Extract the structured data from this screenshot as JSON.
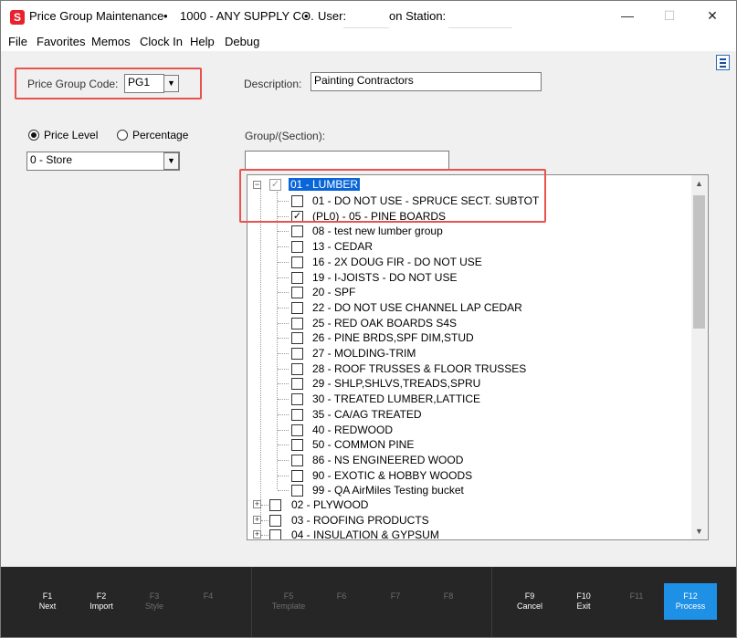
{
  "window": {
    "title": "Price Group Maintenance",
    "company": "1000 - ANY SUPPLY CO.",
    "user_label": "User:",
    "station_label": "on Station:",
    "bullet": "•",
    "minimize": "—",
    "maximize": "☐",
    "close": "✕",
    "app_icon_letter": "S"
  },
  "menu": [
    "File",
    "Favorites",
    "Memos",
    "Clock In",
    "Help",
    "Debug"
  ],
  "form": {
    "price_group_label": "Price Group Code:",
    "price_group_value": "PG1",
    "description_label": "Description:",
    "description_value": "Painting Contractors",
    "radio_price_level": "Price Level",
    "radio_percentage": "Percentage",
    "price_level_value": "0 - Store",
    "group_section_label": "Group/(Section):",
    "group_section_value": ""
  },
  "icons": {
    "dropdown": "▼",
    "collapse": "−",
    "expand": "+",
    "check": "✓",
    "scroll_up": "▲",
    "scroll_down": "▼"
  },
  "tree": {
    "root": {
      "label": "01 - LUMBER",
      "state": "partial",
      "expanded": true
    },
    "children": [
      {
        "label": "01 - DO NOT USE - SPRUCE SECT. SUBTOT",
        "checked": false
      },
      {
        "label": "(PL0) - 05 - PINE BOARDS",
        "checked": true
      },
      {
        "label": "08 - test new lumber group",
        "checked": false
      },
      {
        "label": "13 - CEDAR",
        "checked": false
      },
      {
        "label": "16 - 2X DOUG FIR - DO NOT USE",
        "checked": false
      },
      {
        "label": "19 - I-JOISTS - DO NOT USE",
        "checked": false
      },
      {
        "label": "20 - SPF",
        "checked": false
      },
      {
        "label": "22 - DO NOT USE      CHANNEL LAP CEDAR",
        "checked": false
      },
      {
        "label": "25 - RED OAK BOARDS S4S",
        "checked": false
      },
      {
        "label": "26 - PINE BRDS,SPF DIM,STUD",
        "checked": false
      },
      {
        "label": "27 - MOLDING-TRIM",
        "checked": false
      },
      {
        "label": "28 - ROOF TRUSSES & FLOOR TRUSSES",
        "checked": false
      },
      {
        "label": "29 - SHLP,SHLVS,TREADS,SPRU",
        "checked": false
      },
      {
        "label": "30 - TREATED LUMBER,LATTICE",
        "checked": false
      },
      {
        "label": "35 - CA/AG TREATED",
        "checked": false
      },
      {
        "label": "40 - REDWOOD",
        "checked": false
      },
      {
        "label": "50 - COMMON PINE",
        "checked": false
      },
      {
        "label": "86 - NS ENGINEERED WOOD",
        "checked": false
      },
      {
        "label": "90 - EXOTIC & HOBBY WOODS",
        "checked": false
      },
      {
        "label": "99 - QA AirMiles Testing bucket",
        "checked": false
      }
    ],
    "siblings": [
      {
        "label": "02 - PLYWOOD",
        "checked": false
      },
      {
        "label": "03 - ROOFING PRODUCTS",
        "checked": false
      },
      {
        "label": "04 - INSULATION & GYPSUM",
        "checked": false
      }
    ]
  },
  "fkeys": [
    {
      "key": "F1",
      "action": "Next",
      "enabled": true
    },
    {
      "key": "F2",
      "action": "Import",
      "enabled": true
    },
    {
      "key": "F3",
      "action": "Style",
      "enabled": false
    },
    {
      "key": "F4",
      "action": "",
      "enabled": false
    },
    {
      "key": "F5",
      "action": "Template",
      "enabled": false
    },
    {
      "key": "F6",
      "action": "",
      "enabled": false
    },
    {
      "key": "F7",
      "action": "",
      "enabled": false
    },
    {
      "key": "F8",
      "action": "",
      "enabled": false
    },
    {
      "key": "F9",
      "action": "Cancel",
      "enabled": true
    },
    {
      "key": "F10",
      "action": "Exit",
      "enabled": true
    },
    {
      "key": "F11",
      "action": "",
      "enabled": false
    },
    {
      "key": "F12",
      "action": "Process",
      "enabled": true,
      "primary": true
    }
  ],
  "colors": {
    "accent": "#1e90e6",
    "selection": "#0a66d8",
    "highlight_box": "#e8534f",
    "footer_bg": "#262626",
    "app_icon": "#e8222d"
  }
}
